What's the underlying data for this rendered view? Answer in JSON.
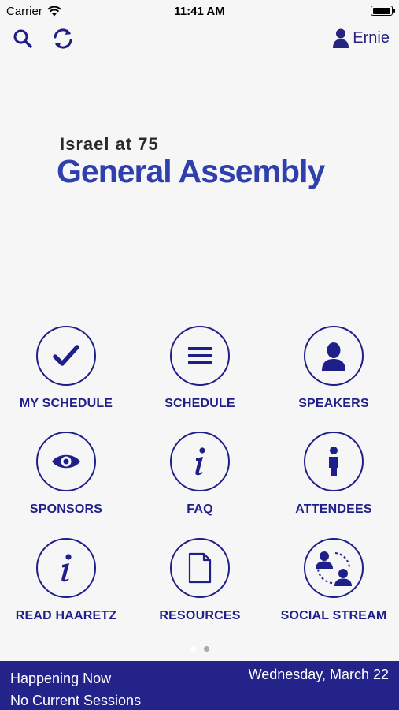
{
  "status_bar": {
    "carrier": "Carrier",
    "time": "11:41 AM"
  },
  "nav": {
    "user_name": "Ernie"
  },
  "logo": {
    "subtitle": "Israel at 75",
    "title": "General Assembly"
  },
  "tiles": [
    {
      "label": "MY SCHEDULE",
      "icon": "checkmark-icon"
    },
    {
      "label": "SCHEDULE",
      "icon": "list-icon"
    },
    {
      "label": "SPEAKERS",
      "icon": "person-icon"
    },
    {
      "label": "SPONSORS",
      "icon": "eye-icon"
    },
    {
      "label": "FAQ",
      "icon": "info-icon"
    },
    {
      "label": "ATTENDEES",
      "icon": "info-person-icon"
    },
    {
      "label": "READ HAARETZ",
      "icon": "info-icon"
    },
    {
      "label": "RESOURCES",
      "icon": "document-icon"
    },
    {
      "label": "SOCIAL STREAM",
      "icon": "social-network-icon"
    }
  ],
  "pager": {
    "page_count": 2,
    "current_page": 1
  },
  "happening_now": {
    "heading": "Happening Now",
    "status": "No Current Sessions",
    "date": "Wednesday, March 22"
  },
  "colors": {
    "accent": "#1f1f8a",
    "brand": "#2f3fab",
    "footer": "#23238a",
    "background": "#f6f6f6"
  }
}
